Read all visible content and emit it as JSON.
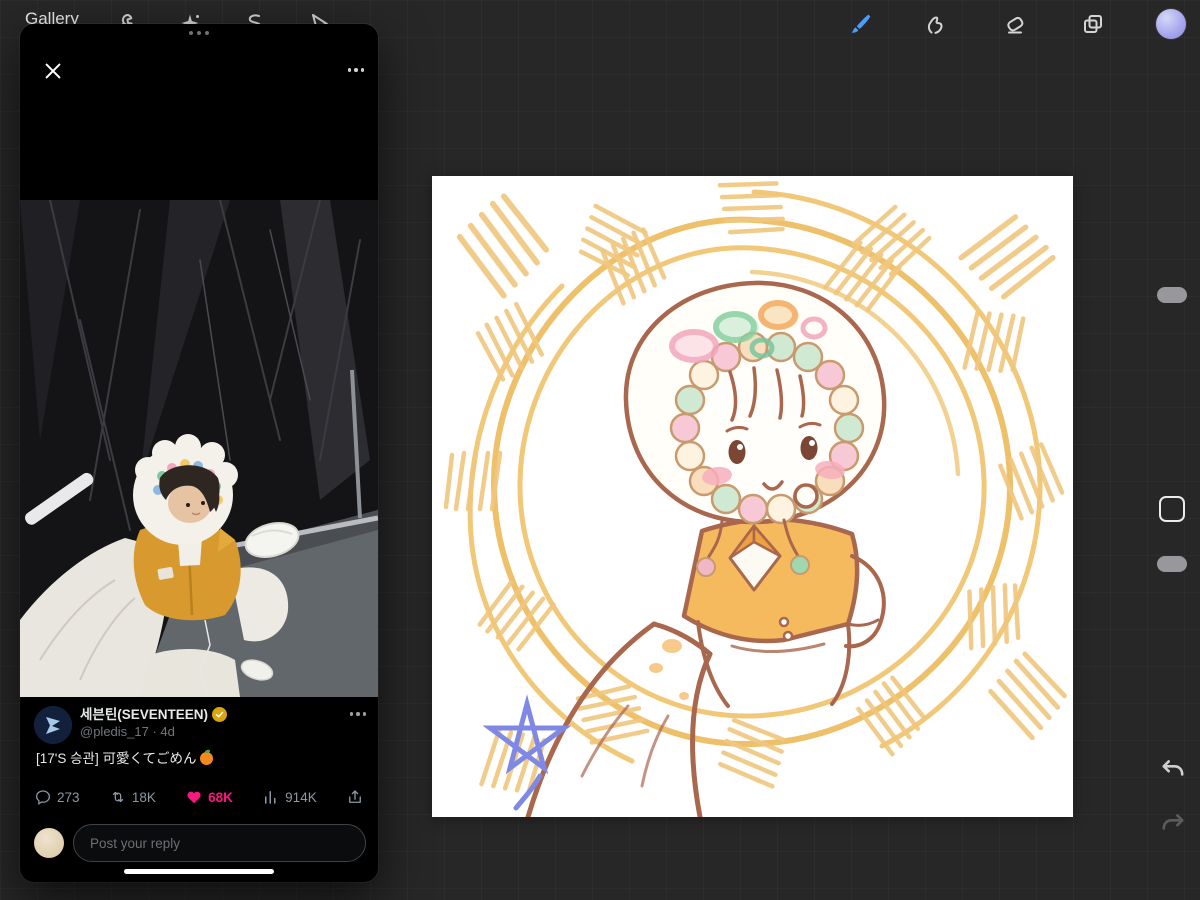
{
  "topbar": {
    "gallery_label": "Gallery",
    "left_tools": [
      "actions-wrench",
      "adjustments-wand",
      "selection-s",
      "transform-arrow"
    ],
    "right_tools": [
      "paint-brush",
      "smudge-finger",
      "eraser",
      "layers",
      "active-color-swatch"
    ],
    "active_tool": "paint-brush"
  },
  "sidebar": {
    "controls": [
      "brush-size-slider",
      "modify-button",
      "opacity-slider",
      "undo",
      "redo"
    ]
  },
  "tweet_window": {
    "author": {
      "name": "세븐틴(SEVENTEEN)",
      "meta": "@pledis_17 · 4d",
      "verified": "gold-check"
    },
    "text": "[17'S 승관] 可愛くてごめん",
    "emoji": "🍊",
    "stats": {
      "replies": "273",
      "reposts": "18K",
      "likes": "68K",
      "views": "914K"
    },
    "reply_placeholder": "Post your reply"
  },
  "colors": {
    "like_red": "#f91880",
    "verified_gold": "#d9a40c",
    "brush_blue": "#4a9df8",
    "sketch_brown": "#a9674e",
    "scribble_yellow": "#f1c571"
  }
}
